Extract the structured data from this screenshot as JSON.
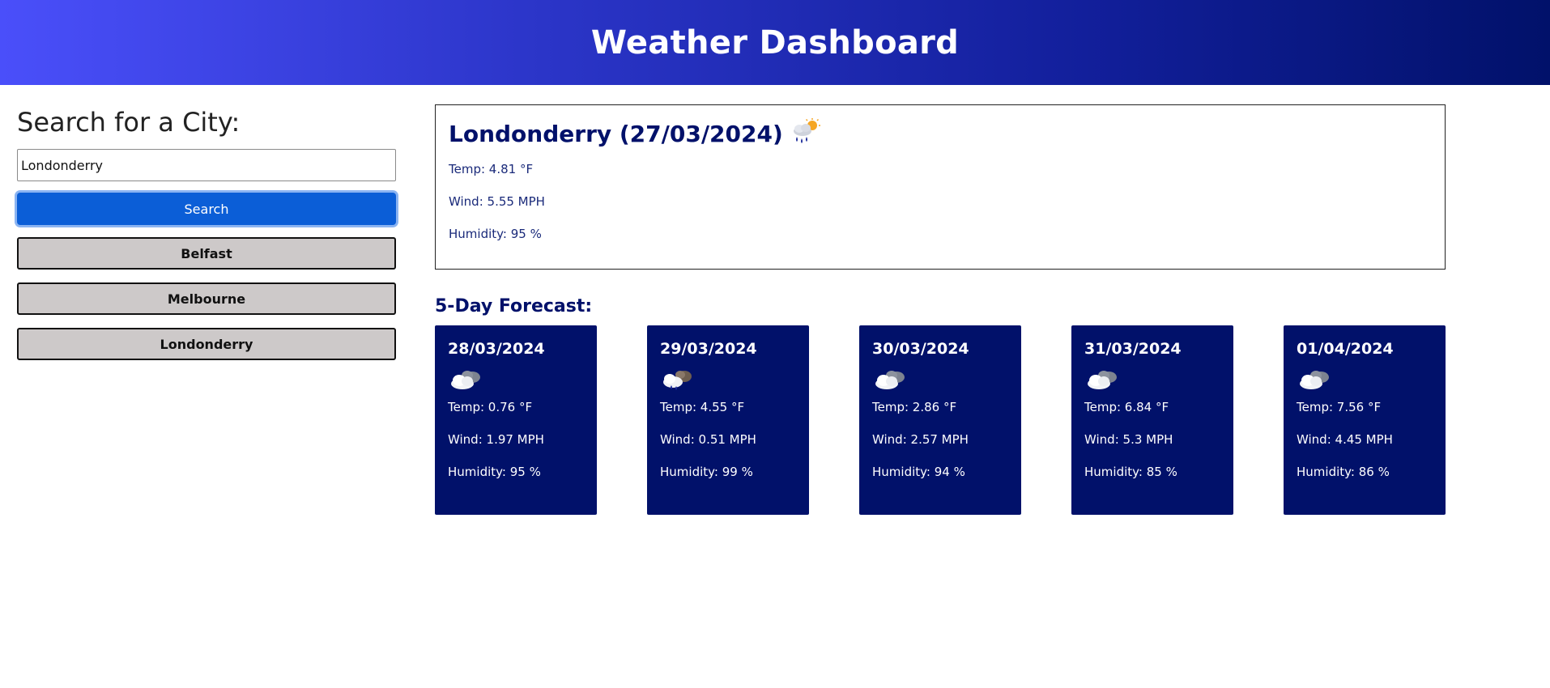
{
  "header": {
    "title": "Weather Dashboard"
  },
  "search": {
    "heading": "Search for a City:",
    "input_value": "Londonderry",
    "button_label": "Search"
  },
  "history": [
    {
      "label": "Belfast"
    },
    {
      "label": "Melbourne"
    },
    {
      "label": "Londonderry"
    }
  ],
  "current": {
    "title": "Londonderry (27/03/2024)",
    "icon": "rain-sun-cloud-icon",
    "temp": "Temp: 4.81 °F",
    "wind": "Wind: 5.55 MPH",
    "humidity": "Humidity: 95 %"
  },
  "forecast": {
    "heading": "5-Day Forecast:",
    "days": [
      {
        "date": "28/03/2024",
        "icon": "cloudy-icon",
        "temp": "Temp: 0.76 °F",
        "wind": "Wind: 1.97 MPH",
        "humidity": "Humidity: 95 %"
      },
      {
        "date": "29/03/2024",
        "icon": "rain-cloud-icon",
        "temp": "Temp: 4.55 °F",
        "wind": "Wind: 0.51 MPH",
        "humidity": "Humidity: 99 %"
      },
      {
        "date": "30/03/2024",
        "icon": "cloudy-icon",
        "temp": "Temp: 2.86 °F",
        "wind": "Wind: 2.57 MPH",
        "humidity": "Humidity: 94 %"
      },
      {
        "date": "31/03/2024",
        "icon": "cloudy-icon",
        "temp": "Temp: 6.84 °F",
        "wind": "Wind: 5.3 MPH",
        "humidity": "Humidity: 85 %"
      },
      {
        "date": "01/04/2024",
        "icon": "cloudy-icon",
        "temp": "Temp: 7.56 °F",
        "wind": "Wind: 4.45 MPH",
        "humidity": "Humidity: 86 %"
      }
    ]
  },
  "colors": {
    "header_gradient_start": "#4a4ffa",
    "header_gradient_end": "#01116a",
    "search_button": "#0b5ed7",
    "history_button": "#cdc9c9",
    "card_background": "#01116a",
    "heading_text": "#01116a"
  }
}
